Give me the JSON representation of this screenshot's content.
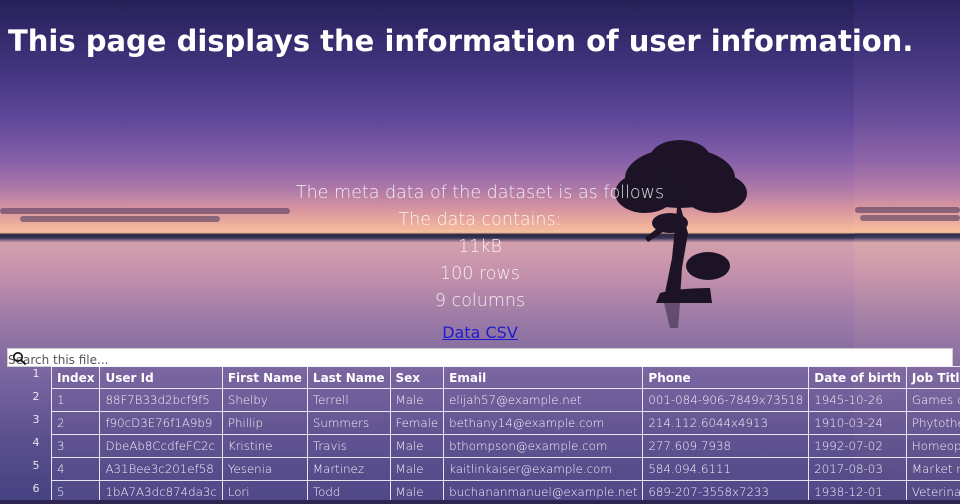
{
  "page": {
    "title": "This page displays the information of user information."
  },
  "meta": {
    "lines": [
      "The meta data of the dataset is as follows",
      "The data contains:",
      "11kB",
      "100 rows",
      "9 columns"
    ],
    "link_label": "Data CSV"
  },
  "search": {
    "placeholder": "Search this file...",
    "icon": "magnifier-icon"
  },
  "table": {
    "row_numbers": [
      "1",
      "2",
      "3",
      "4",
      "5",
      "6"
    ],
    "columns": [
      "Index",
      "User Id",
      "First Name",
      "Last Name",
      "Sex",
      "Email",
      "Phone",
      "Date of birth",
      "Job Title"
    ],
    "rows": [
      [
        "1",
        "88F7B33d2bcf9f5",
        "Shelby",
        "Terrell",
        "Male",
        "elijah57@example.net",
        "001-084-906-7849x73518",
        "1945-10-26",
        "Games developer"
      ],
      [
        "2",
        "f90cD3E76f1A9b9",
        "Phillip",
        "Summers",
        "Female",
        "bethany14@example.com",
        "214.112.6044x4913",
        "1910-03-24",
        "Phytotherapist"
      ],
      [
        "3",
        "DbeAb8CcdfeFC2c",
        "Kristine",
        "Travis",
        "Male",
        "bthompson@example.com",
        "277.609.7938",
        "1992-07-02",
        "Homeopath"
      ],
      [
        "4",
        "A31Bee3c201ef58",
        "Yesenia",
        "Martinez",
        "Male",
        "kaitlinkaiser@example.com",
        "584.094.6111",
        "2017-08-03",
        "Market researcher"
      ],
      [
        "5",
        "1bA7A3dc874da3c",
        "Lori",
        "Todd",
        "Male",
        "buchananmanuel@example.net",
        "689-207-3558x7233",
        "1938-12-01",
        "Veterinary surgeon"
      ]
    ]
  },
  "colors": {
    "title": "#ffffff",
    "link": "#1d1dc9",
    "table_text": "#ffffff"
  }
}
